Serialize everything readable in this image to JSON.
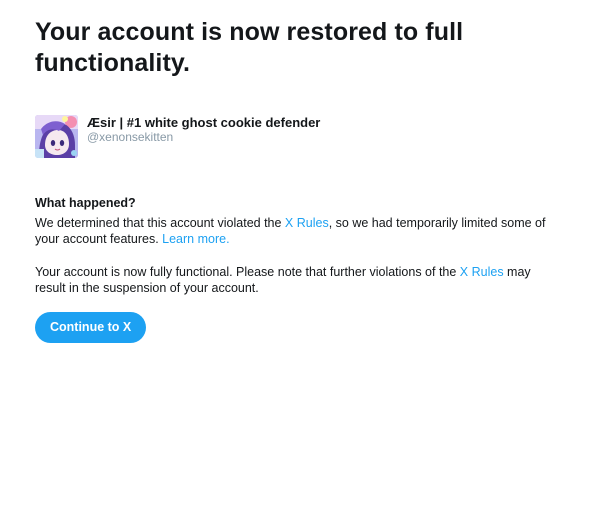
{
  "title": "Your account is now restored to full functionality.",
  "account": {
    "display_name": "Æsir | #1 white ghost cookie defender",
    "handle": "@xenonsekitten"
  },
  "what_happened": {
    "heading": "What happened?",
    "p1_before": "We determined that this account violated the ",
    "p1_link": "X Rules",
    "p1_middle": ", so we had temporarily limited some of your account features. ",
    "p1_learn_more": "Learn more."
  },
  "status": {
    "p2_before": "Your account is now fully functional. Please note that further violations of the ",
    "p2_link": "X Rules",
    "p2_after": " may result in the suspension of your account."
  },
  "button": {
    "label": "Continue to X"
  },
  "colors": {
    "accent": "#1da1f2",
    "text": "#14171a",
    "muted": "#8899a6"
  }
}
